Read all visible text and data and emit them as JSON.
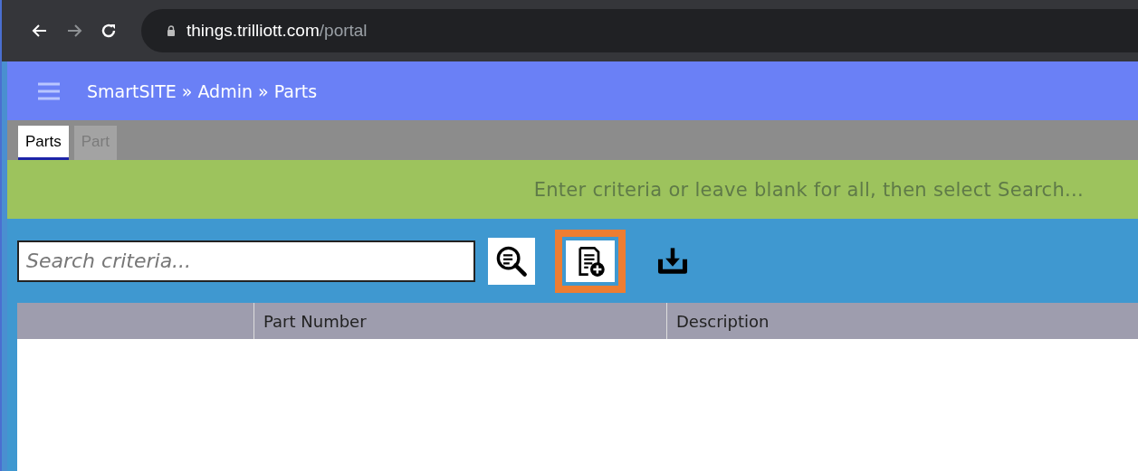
{
  "browser": {
    "url_host": "things.trilliott.com",
    "url_path": "/portal"
  },
  "header": {
    "breadcrumb": "SmartSITE » Admin » Parts"
  },
  "tabs": [
    {
      "label": "Parts",
      "selected": true
    },
    {
      "label": "Part",
      "selected": false
    }
  ],
  "hint": "Enter criteria or leave blank for all, then select Search...",
  "search": {
    "placeholder": "Search criteria..."
  },
  "toolbar": [
    {
      "kind": "search",
      "highlighted": false
    },
    {
      "kind": "add",
      "highlighted": true
    },
    {
      "kind": "download",
      "highlighted": false
    }
  ],
  "table": {
    "columns": [
      "Part Number",
      "Description"
    ]
  }
}
